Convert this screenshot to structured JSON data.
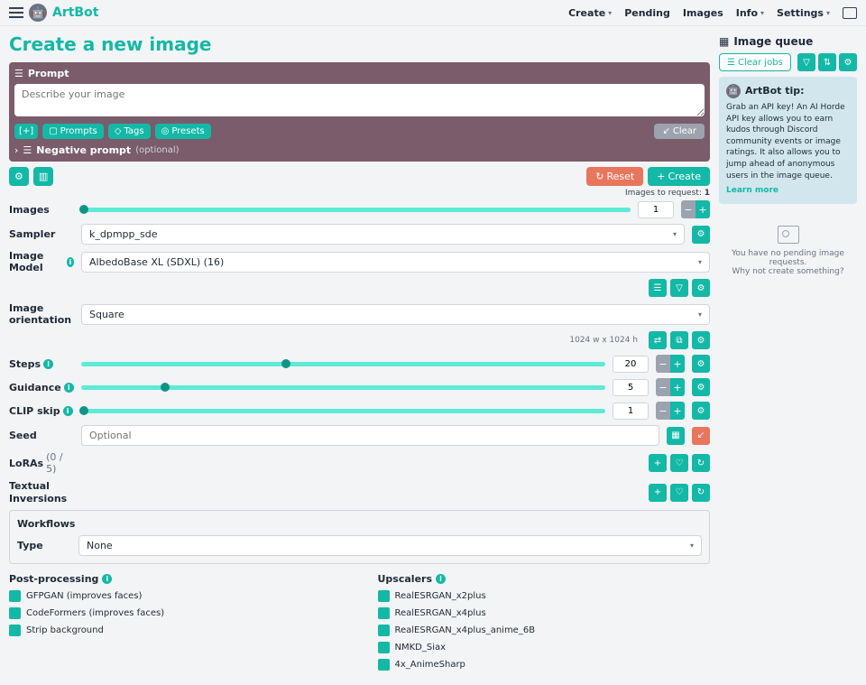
{
  "header": {
    "brand": "ArtBot",
    "nav": {
      "create": "Create",
      "pending": "Pending",
      "images": "Images",
      "info": "Info",
      "settings": "Settings"
    }
  },
  "title": "Create a new image",
  "prompt": {
    "label": "Prompt",
    "placeholder": "Describe your image",
    "chips": {
      "expand": "[+]",
      "prompts": "Prompts",
      "tags": "Tags",
      "presets": "Presets"
    },
    "clear": "Clear",
    "neg": "Negative prompt",
    "optional": "(optional)"
  },
  "actions": {
    "reset": "Reset",
    "create": "Create",
    "req": "Images to request:",
    "reqn": "1"
  },
  "fields": {
    "images": {
      "label": "Images",
      "value": "1"
    },
    "sampler": {
      "label": "Sampler",
      "value": "k_dpmpp_sde"
    },
    "model": {
      "label": "Image Model",
      "value": "AlbedoBase XL (SDXL) (16)"
    },
    "orient": {
      "label": "Image orientation",
      "value": "Square",
      "dim": "1024 w x 1024 h"
    },
    "steps": {
      "label": "Steps",
      "value": "20"
    },
    "guidance": {
      "label": "Guidance",
      "value": "5"
    },
    "clip": {
      "label": "CLIP skip",
      "value": "1"
    },
    "seed": {
      "label": "Seed",
      "placeholder": "Optional"
    },
    "loras": {
      "label": "LoRAs",
      "count": "(0 / 5)"
    },
    "ti": {
      "label": "Textual Inversions"
    },
    "workflows": "Workflows",
    "type": "Type",
    "typeval": "None"
  },
  "pp": {
    "title": "Post-processing",
    "items": [
      "GFPGAN (improves faces)",
      "CodeFormers (improves faces)",
      "Strip background"
    ]
  },
  "up": {
    "title": "Upscalers",
    "items": [
      "RealESRGAN_x2plus",
      "RealESRGAN_x4plus",
      "RealESRGAN_x4plus_anime_6B",
      "NMKD_Siax",
      "4x_AnimeSharp"
    ]
  },
  "queue": {
    "title": "Image queue",
    "clear": "Clear jobs",
    "tiphead": "ArtBot tip:",
    "tip": "Grab an API key! An AI Horde API key allows you to earn kudos through Discord community events or image ratings. It also allows you to jump ahead of anonymous users in the image queue.",
    "learn": "Learn more",
    "empty1": "You have no pending image requests.",
    "empty2": "Why not create something?"
  }
}
